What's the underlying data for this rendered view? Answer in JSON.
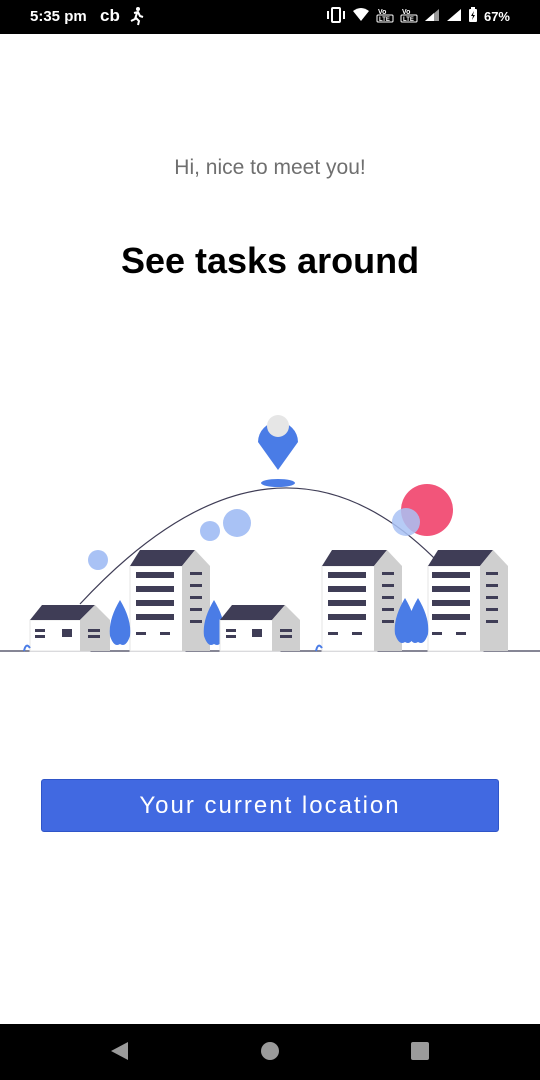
{
  "status_bar": {
    "time": "5:35 pm",
    "app_badge": "cb",
    "battery": "67%",
    "icons": [
      "running-icon",
      "vibrate-icon",
      "wifi-icon",
      "volte1-icon",
      "volte2-icon",
      "signal1-icon",
      "signal2-icon",
      "battery-charging-icon"
    ]
  },
  "main": {
    "greeting": "Hi, nice to meet you!",
    "headline": "See tasks around",
    "illustration": "location-pin-city-icon",
    "button_label": "Your current location"
  },
  "colors": {
    "accent": "#4169E1",
    "pin": "#4A7CE6",
    "building_dark": "#3F3D56",
    "building_light": "#E6E6E6",
    "red_circle": "#F2557A"
  },
  "nav_bar": {
    "icons": [
      "back-icon",
      "home-icon",
      "recents-icon"
    ]
  }
}
